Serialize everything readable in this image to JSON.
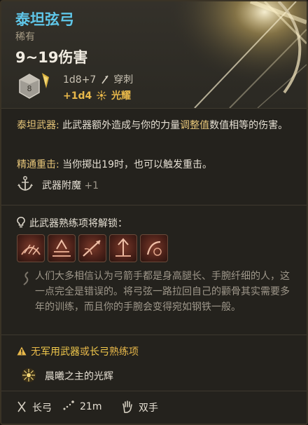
{
  "item": {
    "name": "泰坦弦弓",
    "rarity": "稀有",
    "damage_range": "9~19伤害"
  },
  "damage": {
    "dice_number": "8",
    "base": "1d8+7",
    "base_type": "穿刺",
    "bonus": "+1d4",
    "bonus_type": "光耀"
  },
  "titan_weapon": {
    "label": "泰坦武器:",
    "text_before": " 此武器额外造成与你的力量",
    "keyword": "调整值",
    "text_after": "数值相等的伤害。"
  },
  "mastery_crit": {
    "label": "精通重击:",
    "text": " 当你掷出19时，也可以触发重击。"
  },
  "enchant": {
    "label": "武器附魔",
    "value": "+1"
  },
  "proficiency": {
    "header": "此武器熟练项将解锁："
  },
  "lore": "人们大多相信认为弓箭手都是身高腿长、手腕纤细的人，这一点完全是错误的。将弓弦一路拉回自己的颧骨其实需要多年的训练，而且你的手腕会变得宛如钢铁一般。",
  "warning": {
    "prefix": "无",
    "kw1": "军用武器",
    "mid": "或",
    "kw2": "长弓",
    "suffix": "熟练项"
  },
  "passive": {
    "name": "晨曦之主的光辉"
  },
  "footer": {
    "weapon_type": "长弓",
    "range": "21m",
    "handedness": "双手"
  },
  "colors": {
    "title": "#5fc6e8",
    "accent_gold": "#e8b84a",
    "lore_gray": "#9e978a"
  }
}
